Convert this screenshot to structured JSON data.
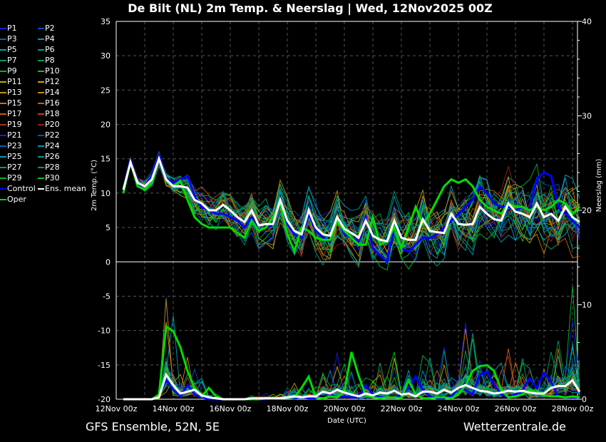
{
  "header": {
    "title": "De Bilt  (NL)  2m Temp. & Neerslag | Wed, 12Nov2025 00Z"
  },
  "footer": {
    "model": "GFS Ensemble, 52N, 5E",
    "source": "Wetterzentrale.de"
  },
  "chart_data": {
    "type": "line",
    "title": "De Bilt  (NL)  2m Temp. & Neerslag | Wed, 12Nov2025 00Z",
    "xlabel": "Date (UTC)",
    "ylabel": "2m Temp. (°C)",
    "y2label": "Neerslag (mm)",
    "ylim": [
      -20,
      35
    ],
    "y2lim": [
      0,
      40
    ],
    "yticks": [
      "35",
      "30",
      "25",
      "20",
      "15",
      "10",
      "5",
      "0",
      "-5",
      "-10",
      "-15",
      "-20"
    ],
    "y2ticks": [
      "40",
      "30",
      "20",
      "10",
      "0"
    ],
    "xticks": [
      "12Nov 00z",
      "14Nov 00z",
      "16Nov 00z",
      "18Nov 00z",
      "20Nov 00z",
      "22Nov 00z",
      "24Nov 00z",
      "26Nov 00z",
      "28Nov 00z"
    ],
    "x_hours_start": 6,
    "x_hours_step": 6,
    "grid": true,
    "legend": {
      "placement": "left-outside",
      "entries": [
        "P1",
        "P2",
        "P3",
        "P4",
        "P5",
        "P6",
        "P7",
        "P8",
        "P9",
        "P10",
        "P11",
        "P12",
        "P13",
        "P14",
        "P15",
        "P16",
        "P17",
        "P18",
        "P19",
        "P20",
        "P21",
        "P22",
        "P23",
        "P24",
        "P25",
        "P26",
        "P27",
        "P28",
        "P29",
        "P30",
        "Control",
        "Ens. mean",
        "Oper"
      ]
    },
    "member_colors": [
      "#1a1ad8",
      "#0050c8",
      "#0064b4",
      "#0096c8",
      "#00a0b4",
      "#00a08c",
      "#00a064",
      "#00a050",
      "#00b432",
      "#00c81e",
      "#b4b400",
      "#c8aa00",
      "#c89600",
      "#c88c00",
      "#c87800",
      "#c86400",
      "#c85a14",
      "#b4461e",
      "#a03228",
      "#961e1e",
      "#1a1ad8",
      "#0050c8",
      "#0064b4",
      "#0096c8",
      "#00a0b4",
      "#00a08c",
      "#00a064",
      "#00a050",
      "#00b432",
      "#00c81e"
    ],
    "series_colors": {
      "control": "#0000ff",
      "mean": "#ffffff",
      "oper": "#00dd00"
    },
    "temp_mean": [
      10.5,
      14.5,
      11.5,
      11,
      12,
      15,
      12,
      11,
      11,
      10.8,
      9,
      8.5,
      7.5,
      7.5,
      8.3,
      7.5,
      6.5,
      5.8,
      7.5,
      5.3,
      5.5,
      5.5,
      9,
      6,
      4.5,
      4,
      7.5,
      5,
      4,
      3.8,
      6.5,
      4.8,
      4.2,
      3.5,
      6,
      3.8,
      3.2,
      3,
      6,
      3.5,
      3.2,
      3.2,
      6.2,
      4.5,
      4.3,
      4.2,
      7,
      5.5,
      5.4,
      5.5,
      8,
      7,
      6.2,
      6,
      8.5,
      7.3,
      7,
      6.5,
      8.5,
      6.5,
      7,
      6,
      8,
      6.5,
      5.8
    ],
    "temp_control": [
      10.5,
      15,
      11.2,
      11,
      12.5,
      15.5,
      12.2,
      11.5,
      12,
      12.5,
      9.5,
      8,
      7.5,
      7,
      7,
      6.5,
      6,
      5,
      6.5,
      4.5,
      5,
      5.5,
      9,
      5.5,
      4,
      3.5,
      7,
      4.5,
      3.5,
      3,
      6.5,
      4,
      3.5,
      3,
      6.5,
      2,
      1,
      0,
      5,
      2,
      1.5,
      2.5,
      3.5,
      3.5,
      4,
      5,
      6,
      7,
      8,
      9,
      11,
      10,
      8.5,
      8,
      8,
      7.5,
      8,
      7.5,
      12,
      13,
      12.5,
      8,
      7,
      6,
      5
    ],
    "temp_oper": [
      10,
      14.5,
      11,
      10.5,
      11.5,
      15,
      12,
      11,
      11.8,
      9,
      6.5,
      5.5,
      5,
      5,
      5,
      5,
      4.2,
      3.5,
      6,
      4.5,
      5,
      6.5,
      8.5,
      4,
      1.5,
      5,
      4.5,
      3.5,
      3.2,
      3.2,
      6,
      4.5,
      3.5,
      2.5,
      2.5,
      6.5,
      2.5,
      3,
      5,
      2,
      5,
      8,
      5.5,
      7,
      9,
      11,
      12,
      11.5,
      12,
      11,
      9,
      8,
      7.5,
      7,
      8.5,
      8,
      8,
      7.5,
      8,
      7.5,
      8,
      9,
      8.5,
      7,
      8
    ],
    "temp_spread": [
      0.5,
      0.6,
      0.6,
      0.7,
      0.8,
      0.8,
      1,
      1,
      1.2,
      1.5,
      1.8,
      2,
      2,
      2.2,
      2.2,
      2.3,
      2.4,
      2.5,
      2.5,
      2.5,
      2.6,
      2.6,
      2.6,
      2.7,
      2.7,
      2.8,
      2.8,
      2.8,
      2.9,
      2.9,
      3,
      3,
      3,
      3,
      3.1,
      3.1,
      3.2,
      3.2,
      3.2,
      3.3,
      3.3,
      3.4,
      3.4,
      3.4,
      3.5,
      3.5,
      3.5,
      3.5,
      3.6,
      3.6,
      3.6,
      3.6,
      3.7,
      3.7,
      3.7,
      3.8,
      3.8,
      3.8,
      3.8,
      3.9,
      3.9,
      3.9,
      4,
      4,
      4
    ],
    "precip_mean": [
      0,
      0,
      0,
      0,
      0,
      0.2,
      2.6,
      1.5,
      0.6,
      0.8,
      1.0,
      0.4,
      0.2,
      0.1,
      0,
      0,
      0,
      0,
      0.1,
      0.1,
      0.1,
      0.1,
      0.1,
      0.2,
      0.3,
      0.2,
      0.3,
      0.3,
      0.8,
      0.6,
      1.0,
      0.7,
      0.5,
      0.3,
      0.6,
      0.4,
      0.7,
      0.6,
      0.9,
      0.5,
      0.6,
      0.3,
      0.8,
      0.8,
      0.6,
      1.0,
      0.7,
      1.2,
      1.5,
      1.2,
      0.9,
      0.8,
      0.6,
      0.7,
      0.9,
      0.8,
      0.9,
      0.7,
      0.6,
      0.6,
      1.2,
      1.4,
      1.4,
      2.0,
      0.8
    ],
    "precip_control": [
      0,
      0,
      0,
      0,
      0,
      0.3,
      2,
      1,
      0.3,
      1.5,
      0.5,
      0.2,
      0,
      0,
      0,
      0,
      0,
      0,
      0,
      0,
      0,
      0.1,
      0.1,
      0.2,
      0.1,
      0.2,
      0.1,
      0.1,
      0.8,
      0.5,
      0.2,
      0.3,
      0.2,
      0.2,
      1.5,
      0.5,
      0.2,
      0.2,
      0.2,
      0.5,
      1.2,
      2.4,
      1.0,
      0.3,
      0.1,
      0.1,
      0.3,
      1.2,
      1.0,
      0.5,
      2.6,
      2.9,
      1.6,
      0.5,
      0.3,
      0.5,
      1.0,
      2.2,
      1.2,
      2.8,
      1.8,
      0.3,
      0.2,
      0.2,
      0.2
    ],
    "precip_oper": [
      0,
      0,
      0,
      0,
      0,
      0.5,
      7.7,
      7.2,
      5.5,
      3,
      1.1,
      0.3,
      1.2,
      0.3,
      0,
      0,
      0,
      0,
      0,
      0,
      0.1,
      0.1,
      0.1,
      0.2,
      0.2,
      1.2,
      2.4,
      0.2,
      0.1,
      0.3,
      0.2,
      0.8,
      5.0,
      2.5,
      0.4,
      0.2,
      0.1,
      0.2,
      0.2,
      0.1,
      2.0,
      0.5,
      0.1,
      0.1,
      0.2,
      0.2,
      0.1,
      0.5,
      1.5,
      3.0,
      3.5,
      3.6,
      3.0,
      1.0,
      0.2,
      0.3,
      0.5,
      1.0,
      0.7,
      0.4,
      0.3,
      0.3,
      0.2,
      0.3,
      0.2
    ]
  }
}
